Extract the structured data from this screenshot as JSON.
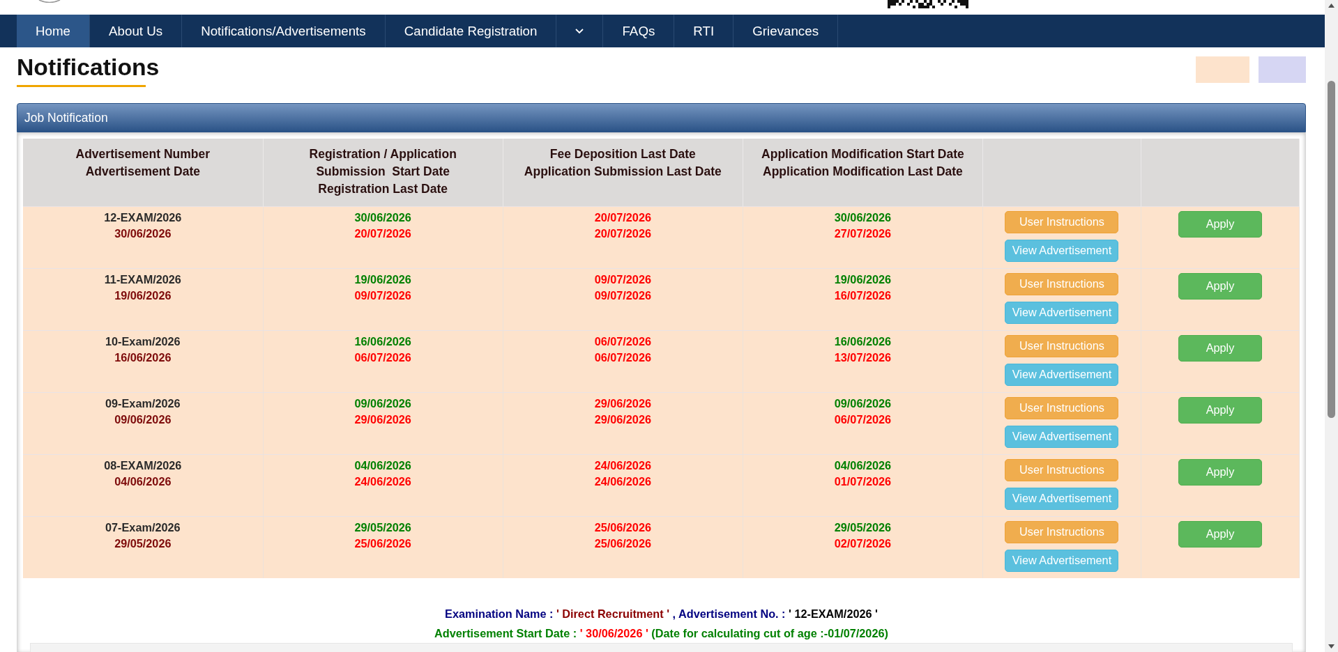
{
  "nav": [
    {
      "kind": "link",
      "label": "Home",
      "selected": true
    },
    {
      "kind": "link",
      "label": "About Us",
      "selected": false
    },
    {
      "kind": "link",
      "label": "Notifications/Advertisements",
      "selected": false
    },
    {
      "kind": "link",
      "label": "Candidate Registration",
      "selected": false
    },
    {
      "kind": "dropdown",
      "selected": false
    },
    {
      "kind": "link",
      "label": "FAQs",
      "selected": false
    },
    {
      "kind": "link",
      "label": "RTI",
      "selected": false
    },
    {
      "kind": "link",
      "label": "Grievances",
      "selected": false
    }
  ],
  "page_title": "Notifications",
  "legend": [
    {
      "color": "#fde3cc"
    },
    {
      "color": "#d6d6f3"
    }
  ],
  "panel": {
    "title": "Job Notification",
    "table": {
      "columns": [
        {
          "kind": "text",
          "lines": [
            "Advertisement Number",
            "Advertisement Date"
          ]
        },
        {
          "kind": "text",
          "lines": [
            "Registration / Application",
            "Submission  Start Date",
            "Registration Last Date"
          ]
        },
        {
          "kind": "text",
          "lines": [
            "Fee Deposition Last Date",
            "Application Submission Last Date"
          ]
        },
        {
          "kind": "text",
          "lines": [
            "Application Modification Start Date",
            "Application Modification Last Date"
          ]
        },
        {
          "kind": "actions"
        },
        {
          "kind": "apply"
        }
      ],
      "rows": [
        {
          "advertisement_number": "12-EXAM/2026",
          "advertisement_date": "30/06/2026",
          "registration_start": "30/06/2026",
          "registration_last": "20/07/2026",
          "fee_last": "20/07/2026",
          "submission_last": "20/07/2026",
          "modification_start": "30/06/2026",
          "modification_last": "27/07/2026",
          "buttons": [
            {
              "kind": "instructions",
              "label": "User Instructions"
            },
            {
              "kind": "advertisement",
              "label": "View Advertisement"
            }
          ],
          "apply": "Apply"
        },
        {
          "advertisement_number": "11-EXAM/2026",
          "advertisement_date": "19/06/2026",
          "registration_start": "19/06/2026",
          "registration_last": "09/07/2026",
          "fee_last": "09/07/2026",
          "submission_last": "09/07/2026",
          "modification_start": "19/06/2026",
          "modification_last": "16/07/2026",
          "buttons": [
            {
              "kind": "instructions",
              "label": "User Instructions"
            },
            {
              "kind": "advertisement",
              "label": "View Advertisement"
            }
          ],
          "apply": "Apply"
        },
        {
          "advertisement_number": "10-Exam/2026",
          "advertisement_date": "16/06/2026",
          "registration_start": "16/06/2026",
          "registration_last": "06/07/2026",
          "fee_last": "06/07/2026",
          "submission_last": "06/07/2026",
          "modification_start": "16/06/2026",
          "modification_last": "13/07/2026",
          "buttons": [
            {
              "kind": "instructions",
              "label": "User Instructions"
            },
            {
              "kind": "advertisement",
              "label": "View Advertisement"
            }
          ],
          "apply": "Apply"
        },
        {
          "advertisement_number": "09-Exam/2026",
          "advertisement_date": "09/06/2026",
          "registration_start": "09/06/2026",
          "registration_last": "29/06/2026",
          "fee_last": "29/06/2026",
          "submission_last": "29/06/2026",
          "modification_start": "09/06/2026",
          "modification_last": "06/07/2026",
          "buttons": [
            {
              "kind": "instructions",
              "label": "User Instructions"
            },
            {
              "kind": "advertisement",
              "label": "View Advertisement"
            }
          ],
          "apply": "Apply"
        },
        {
          "advertisement_number": "08-EXAM/2026",
          "advertisement_date": "04/06/2026",
          "registration_start": "04/06/2026",
          "registration_last": "24/06/2026",
          "fee_last": "24/06/2026",
          "submission_last": "24/06/2026",
          "modification_start": "04/06/2026",
          "modification_last": "01/07/2026",
          "buttons": [
            {
              "kind": "instructions",
              "label": "User Instructions"
            },
            {
              "kind": "advertisement",
              "label": "View Advertisement"
            }
          ],
          "apply": "Apply"
        },
        {
          "advertisement_number": "07-Exam/2026",
          "advertisement_date": "29/05/2026",
          "registration_start": "29/05/2026",
          "registration_last": "25/06/2026",
          "fee_last": "25/06/2026",
          "submission_last": "25/06/2026",
          "modification_start": "29/05/2026",
          "modification_last": "02/07/2026",
          "buttons": [
            {
              "kind": "instructions",
              "label": "User Instructions"
            },
            {
              "kind": "advertisement",
              "label": "View Advertisement"
            }
          ],
          "apply": "Apply"
        }
      ]
    },
    "summary": [
      {
        "parts": [
          {
            "kind": "label",
            "text": "Examination Name : "
          },
          {
            "kind": "name",
            "text": "' Direct Recruitment '"
          },
          {
            "kind": "label",
            "text": " , Advertisement No. : "
          },
          {
            "kind": "number",
            "text": "' 12-EXAM/2026 '"
          }
        ]
      },
      {
        "parts": [
          {
            "kind": "date-label",
            "text": "Advertisement Start Date : "
          },
          {
            "kind": "date",
            "text": "' 30/06/2026 '"
          },
          {
            "kind": "note",
            "text": " (Date for calculating cut of age :-01/07/2026)"
          }
        ]
      }
    ]
  }
}
